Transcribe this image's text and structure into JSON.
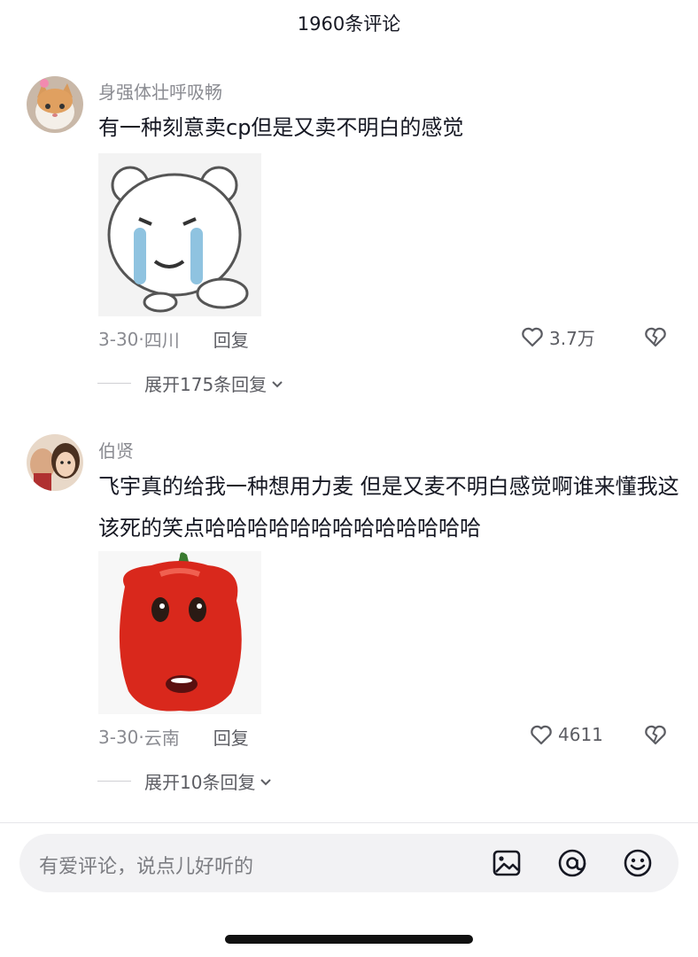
{
  "header": {
    "title": "1960条评论"
  },
  "comments": [
    {
      "username": "身强体壮呼吸畅",
      "text": "有一种刻意卖cp但是又卖不明白的感觉",
      "sticker_icon": "crying-bear-sticker",
      "date": "3-30",
      "location": "四川",
      "reply_label": "回复",
      "likes": "3.7万",
      "expand_label": "展开175条回复"
    },
    {
      "username": "伯贤",
      "text": "飞宇真的给我一种想用力麦 但是又麦不明白感觉啊谁来懂我这该死的笑点哈哈哈哈哈哈哈哈哈哈哈哈哈",
      "sticker_icon": "red-pepper-face-sticker",
      "date": "3-30",
      "location": "云南",
      "reply_label": "回复",
      "likes": "4611",
      "expand_label": "展开10条回复"
    }
  ],
  "input": {
    "placeholder": "有爱评论，说点儿好听的"
  },
  "colors": {
    "secondary_text": "#8a8b91",
    "primary_text": "#161823",
    "input_bg": "#f2f2f4"
  }
}
